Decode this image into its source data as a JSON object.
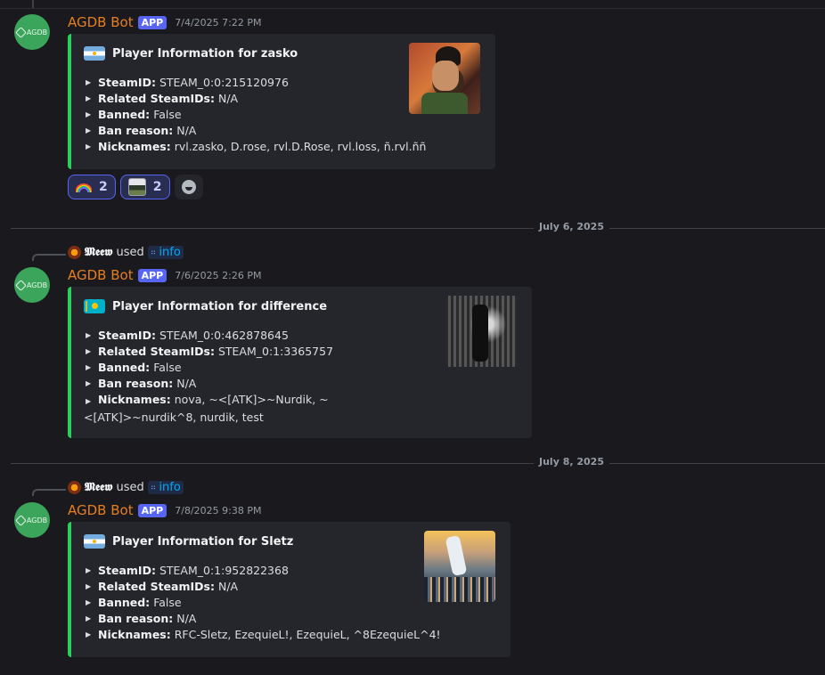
{
  "messages": [
    {
      "author": "AGDB Bot",
      "badge": "APP",
      "timestamp": "7/4/2025 7:22 PM",
      "avatar_text": "AGDB",
      "embed": {
        "title": "Player Information for zasko",
        "flag": "argentina-flag",
        "fields": [
          {
            "key": "SteamID:",
            "value": "STEAM_0:0:215120976"
          },
          {
            "key": "Related SteamIDs:",
            "value": "N/A"
          },
          {
            "key": "Banned:",
            "value": "False"
          },
          {
            "key": "Ban reason:",
            "value": "N/A"
          },
          {
            "key": "Nicknames:",
            "value": "rvl.zasko, D.rose, rvl.D.Rose, rvl.loss, ñ.rvl.ññ"
          }
        ]
      },
      "reactions": [
        {
          "emoji": "rainbow-emoji",
          "count": "2"
        },
        {
          "emoji": "custom-emoji",
          "count": "2"
        }
      ]
    },
    {
      "reply": {
        "user": "𝕸𝖊𝖊𝖜",
        "text": "used",
        "command": "info"
      },
      "author": "AGDB Bot",
      "badge": "APP",
      "timestamp": "7/6/2025 2:26 PM",
      "avatar_text": "AGDB",
      "embed": {
        "title": "Player Information for difference",
        "flag": "kazakhstan-flag",
        "fields": [
          {
            "key": "SteamID:",
            "value": "STEAM_0:0:462878645"
          },
          {
            "key": "Related SteamIDs:",
            "value": "STEAM_0:1:3365757"
          },
          {
            "key": "Banned:",
            "value": "False"
          },
          {
            "key": "Ban reason:",
            "value": "N/A"
          },
          {
            "key": "Nicknames:",
            "value": "nova, ~<[ATK]>~Nurdik, ~<[ATK]>~nurdik^8, nurdik, test"
          }
        ]
      }
    },
    {
      "reply": {
        "user": "𝕸𝖊𝖊𝖜",
        "text": "used",
        "command": "info"
      },
      "author": "AGDB Bot",
      "badge": "APP",
      "timestamp": "7/8/2025 9:38 PM",
      "avatar_text": "AGDB",
      "embed": {
        "title": "Player Information for Sletz",
        "flag": "argentina-flag",
        "fields": [
          {
            "key": "SteamID:",
            "value": "STEAM_0:1:952822368"
          },
          {
            "key": "Related SteamIDs:",
            "value": "N/A"
          },
          {
            "key": "Banned:",
            "value": "False"
          },
          {
            "key": "Ban reason:",
            "value": "N/A"
          },
          {
            "key": "Nicknames:",
            "value": "RFC-Sletz, EzequieL!, EzequieL, ^8EzequieL^4!"
          }
        ]
      }
    }
  ],
  "dividers": [
    "July 6, 2025",
    "July 8, 2025"
  ],
  "colors": {
    "username": "#e67e22",
    "app_badge": "#5865f2",
    "embed_accent": "#2dcd5b",
    "background": "#1a1a1e",
    "embed_bg": "#25262b",
    "link": "#00a8fc"
  }
}
